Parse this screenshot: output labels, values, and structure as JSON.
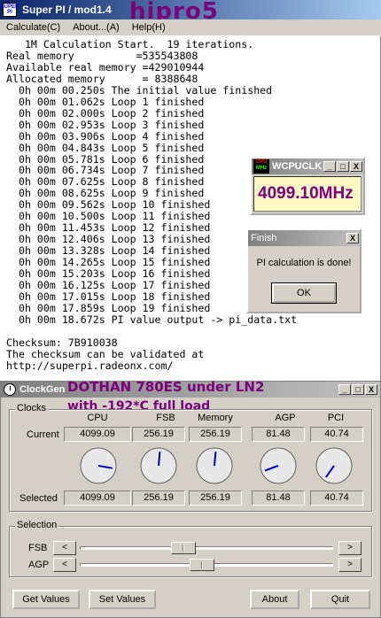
{
  "superpi": {
    "icon_text": "SUPER PI",
    "title": "Super PI / mod1.4",
    "overlay": "hipro5",
    "menu": [
      "Calculate(C)",
      "About...(A)",
      "Help(H)"
    ],
    "console_lines": [
      "   1M Calculation Start.  19 iterations.",
      "Real memory          =535543808",
      "Available real memory =429010944",
      "Allocated memory      = 8388648",
      "  0h 00m 00.250s The initial value finished",
      "  0h 00m 01.062s Loop 1 finished",
      "  0h 00m 02.000s Loop 2 finished",
      "  0h 00m 02.953s Loop 3 finished",
      "  0h 00m 03.906s Loop 4 finished",
      "  0h 00m 04.843s Loop 5 finished",
      "  0h 00m 05.781s Loop 6 finished",
      "  0h 00m 06.734s Loop 7 finished",
      "  0h 00m 07.625s Loop 8 finished",
      "  0h 00m 08.625s Loop 9 finished",
      "  0h 00m 09.562s Loop 10 finished",
      "  0h 00m 10.500s Loop 11 finished",
      "  0h 00m 11.453s Loop 12 finished",
      "  0h 00m 12.406s Loop 13 finished",
      "  0h 00m 13.328s Loop 14 finished",
      "  0h 00m 14.265s Loop 15 finished",
      "  0h 00m 15.203s Loop 16 finished",
      "  0h 00m 16.125s Loop 17 finished",
      "  0h 00m 17.015s Loop 18 finished",
      "  0h 00m 17.859s Loop 19 finished",
      "  0h 00m 18.672s PI value output -> pi_data.txt",
      "",
      "Checksum: 7B910038",
      "The checksum can be validated at",
      "http://superpi.radeonx.com/"
    ]
  },
  "wcpuclk": {
    "logo_top": "CPU",
    "logo_bottom": "MHz",
    "title": "WCPUCLK",
    "frequency": "4099.10MHz"
  },
  "finish": {
    "title": "Finish",
    "message": "PI calculation is done!",
    "ok_label": "OK"
  },
  "clockgen": {
    "title": "ClockGen",
    "overlay_line1": "DOTHAN 780ES under LN2",
    "overlay_line2": "with -192*C full load",
    "clocks_group": "Clocks",
    "columns": [
      "CPU",
      "FSB",
      "Memory",
      "AGP",
      "PCI"
    ],
    "row_current": "Current",
    "row_selected": "Selected",
    "current_values": [
      "4099.09",
      "256.19",
      "256.19",
      "81.48",
      "40.74"
    ],
    "selected_values": [
      "4099.09",
      "256.19",
      "256.19",
      "81.48",
      "40.74"
    ],
    "gauge_needle_degrees": [
      100,
      5,
      5,
      250,
      215
    ],
    "selection_group": "Selection",
    "sliders": [
      {
        "label": "FSB",
        "position_fraction": 0.4
      },
      {
        "label": "AGP",
        "position_fraction": 0.48
      }
    ],
    "slider_left_glyph": "<",
    "slider_right_glyph": ">",
    "buttons": [
      "Get Values",
      "Set Values",
      "About",
      "Quit"
    ]
  },
  "window_controls": {
    "minimize": "_",
    "maximize": "□",
    "close": "X"
  }
}
